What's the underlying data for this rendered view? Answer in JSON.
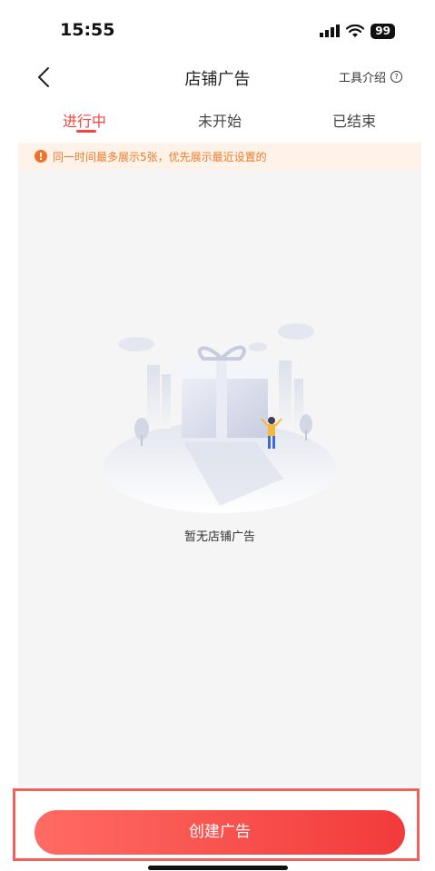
{
  "status_bar": {
    "time": "15:55",
    "battery": "99"
  },
  "nav": {
    "title": "店铺广告",
    "tool_intro": "工具介绍",
    "help_symbol": "?"
  },
  "tabs": [
    {
      "label": "进行中",
      "active": true
    },
    {
      "label": "未开始",
      "active": false
    },
    {
      "label": "已结束",
      "active": false
    }
  ],
  "notice": {
    "text": "同一时间最多展示5张，优先展示最近设置的"
  },
  "empty_state": {
    "text": "暂无店铺广告"
  },
  "bottom": {
    "create_button": "创建广告"
  },
  "colors": {
    "accent": "#f0463f",
    "notice_bg": "#fff2e8",
    "notice_text": "#ee7b2d",
    "content_bg": "#f5f5f5"
  }
}
